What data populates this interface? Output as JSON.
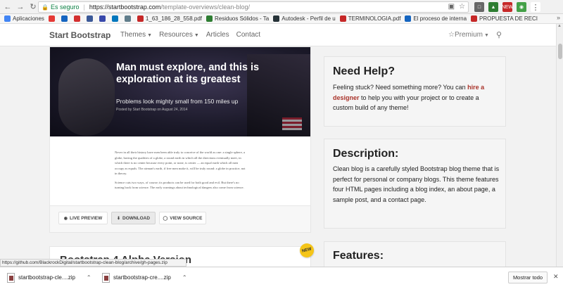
{
  "browser": {
    "secure_label": "Es seguro",
    "url_host": "https://startbootstrap.com",
    "url_path": "/template-overviews/clean-blog/",
    "new_badge": "NEW"
  },
  "bookmarks": [
    {
      "label": "Aplicaciones",
      "color": "#4285f4"
    },
    {
      "label": "",
      "color": "#e53935"
    },
    {
      "label": "",
      "color": "#1565c0"
    },
    {
      "label": "",
      "color": "#d32f2f"
    },
    {
      "label": "",
      "color": "#3b5998"
    },
    {
      "label": "",
      "color": "#3949ab"
    },
    {
      "label": "",
      "color": "#0277bd"
    },
    {
      "label": "",
      "color": "#607d8b"
    },
    {
      "label": "1_63_186_28_558.pdf",
      "color": "#c62828"
    },
    {
      "label": "Residuos Sólidos - Ta",
      "color": "#2e7d32"
    },
    {
      "label": "Autodesk - Perfil de u",
      "color": "#263238"
    },
    {
      "label": "TERMINOLOGIA.pdf",
      "color": "#c62828"
    },
    {
      "label": "El proceso de interna",
      "color": "#1565c0"
    },
    {
      "label": "PROPUESTA DE RECI",
      "color": "#c62828"
    }
  ],
  "site": {
    "brand": "Start Bootstrap",
    "nav": [
      "Themes",
      "Resources",
      "Articles",
      "Contact"
    ],
    "premium": "Premium"
  },
  "template": {
    "hero_title": "Man must explore, and this is exploration at its greatest",
    "hero_subtitle": "Problems look mighty small from 150 miles up",
    "hero_meta": "Posted by Start Bootstrap on August 24, 2014",
    "body_p1": "Never in all their history have men been able truly to conceive of the world as one: a single sphere, a globe, having the qualities of a globe, a round earth in which all the directions eventually meet, in which there is no center because every point, or none, is center — an equal earth which all men occupy as equals. The airman's earth, if free men make it, will be truly round: a globe in practice, not in theory.",
    "body_p2": "Science cuts two ways, of course; its products can be used for both good and evil. But there's no turning back from science. The early warnings about technological dangers also come from science.",
    "buttons": {
      "preview": "LIVE PREVIEW",
      "download": "DOWNLOAD",
      "source": "VIEW SOURCE"
    }
  },
  "card2_title": "Bootstrap 4 Alpha Version",
  "help": {
    "title": "Need Help?",
    "text_before": "Feeling stuck? Need something more? You can ",
    "link": "hire a designer",
    "text_after": " to help you with your project or to create a custom build of any theme!"
  },
  "description": {
    "title": "Description:",
    "text": "Clean blog is a carefully styled Bootstrap blog theme that is perfect for personal or company blogs. This theme features four HTML pages including a blog index, an about page, a sample post, and a contact page."
  },
  "features": {
    "title": "Features:"
  },
  "status_url": "https://github.com/BlackrockDigital/startbootstrap-clean-blog/archive/gh-pages.zip",
  "downloads": {
    "items": [
      "startbootstrap-cle....zip",
      "startbootstrap-cre....zip"
    ],
    "show_all": "Mostrar todo"
  }
}
